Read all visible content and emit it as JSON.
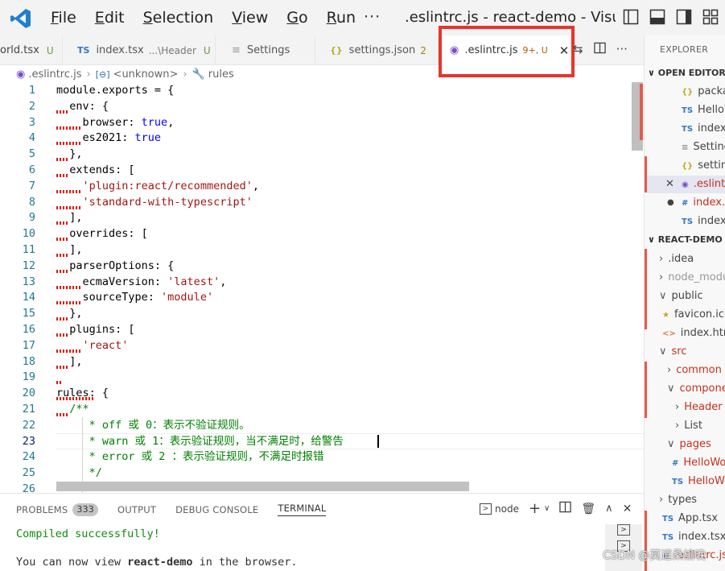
{
  "titlebar": {
    "menus": [
      "File",
      "Edit",
      "Selection",
      "View",
      "Go",
      "Run"
    ],
    "menu_accel": [
      "F",
      "E",
      "S",
      "V",
      "G",
      "R"
    ],
    "more": "···",
    "title": ".eslintrc.js - react-demo - Visual Studio Code"
  },
  "tabs": [
    {
      "label": "orld.tsx",
      "status": "U"
    },
    {
      "icon": "TS",
      "label": "index.tsx",
      "desc": "...\\Header",
      "status": "U"
    },
    {
      "label": "Settings"
    },
    {
      "icon": "{}",
      "label": "settings.json",
      "status": "2"
    },
    {
      "label": ".eslintrc.js",
      "status": "9+, U"
    }
  ],
  "breadcrumb": [
    ".eslintrc.js",
    "<unknown>",
    "rules"
  ],
  "code": [
    {
      "n": "1",
      "t": [
        [
          "t",
          "module.exports = {"
        ]
      ]
    },
    {
      "n": "2",
      "t": [
        [
          "t",
          "  env: {"
        ]
      ]
    },
    {
      "n": "3",
      "t": [
        [
          "t",
          "    browser: "
        ],
        [
          "k",
          "true"
        ],
        [
          "t",
          ","
        ]
      ]
    },
    {
      "n": "4",
      "t": [
        [
          "t",
          "    es2021: "
        ],
        [
          "k",
          "true"
        ]
      ]
    },
    {
      "n": "5",
      "t": [
        [
          "t",
          "  },"
        ]
      ]
    },
    {
      "n": "6",
      "t": [
        [
          "t",
          "  extends: ["
        ]
      ]
    },
    {
      "n": "7",
      "t": [
        [
          "t",
          "    "
        ],
        [
          "s",
          "'plugin:react/recommended'"
        ],
        [
          "t",
          ","
        ]
      ]
    },
    {
      "n": "8",
      "t": [
        [
          "t",
          "    "
        ],
        [
          "s",
          "'standard-with-typescript'"
        ]
      ]
    },
    {
      "n": "9",
      "t": [
        [
          "t",
          "  ],"
        ]
      ]
    },
    {
      "n": "10",
      "t": [
        [
          "t",
          "  overrides: ["
        ]
      ]
    },
    {
      "n": "11",
      "t": [
        [
          "t",
          "  ],"
        ]
      ]
    },
    {
      "n": "12",
      "t": [
        [
          "t",
          "  parserOptions: {"
        ]
      ]
    },
    {
      "n": "13",
      "t": [
        [
          "t",
          "    ecmaVersion: "
        ],
        [
          "s",
          "'latest'"
        ],
        [
          "t",
          ","
        ]
      ]
    },
    {
      "n": "14",
      "t": [
        [
          "t",
          "    sourceType: "
        ],
        [
          "s",
          "'module'"
        ]
      ]
    },
    {
      "n": "15",
      "t": [
        [
          "t",
          "  },"
        ]
      ]
    },
    {
      "n": "16",
      "t": [
        [
          "t",
          "  plugins: ["
        ]
      ]
    },
    {
      "n": "17",
      "t": [
        [
          "t",
          "    "
        ],
        [
          "s",
          "'react'"
        ]
      ]
    },
    {
      "n": "18",
      "t": [
        [
          "t",
          "  ],"
        ]
      ]
    },
    {
      "n": "19",
      "t": [
        [
          "t",
          ""
        ]
      ]
    },
    {
      "n": "20",
      "t": [
        [
          "t",
          "rules: {"
        ]
      ]
    },
    {
      "n": "21",
      "t": [
        [
          "c",
          "  /**"
        ]
      ]
    },
    {
      "n": "22",
      "t": [
        [
          "c",
          "     * off 或 0：表示不验证规则。"
        ]
      ]
    },
    {
      "n": "23",
      "t": [
        [
          "c",
          "     * warn 或 1：表示验证规则，当不满足时，给警告"
        ]
      ]
    },
    {
      "n": "24",
      "t": [
        [
          "c",
          "     * error 或 2 ：表示验证规则，不满足时报错"
        ]
      ]
    },
    {
      "n": "25",
      "t": [
        [
          "c",
          "     */"
        ]
      ]
    },
    {
      "n": "26",
      "t": [
        [
          "t",
          ""
        ]
      ]
    }
  ],
  "panel": {
    "tabs": [
      "PROBLEMS",
      "OUTPUT",
      "DEBUG CONSOLE",
      "TERMINAL"
    ],
    "problems_count": "333",
    "shell": "node",
    "line1": "Compiled successfully!",
    "line2_pre": "You can now view ",
    "line2_bold": "react-demo",
    "line2_post": " in the browser."
  },
  "explorer": {
    "title": "EXPLORER",
    "open_editors": "OPEN EDITORS",
    "open": [
      {
        "icon": "{}",
        "label": "package.json"
      },
      {
        "icon": "TS",
        "label": "HelloWorld.tsx"
      },
      {
        "icon": "TS",
        "label": "index.tsx"
      },
      {
        "icon": "≡",
        "label": "Settings"
      },
      {
        "icon": "{}",
        "label": "settings.json"
      },
      {
        "icon": "◉",
        "label": ".eslintrc.js"
      },
      {
        "icon": "#",
        "label": "index.css"
      },
      {
        "icon": "TS",
        "label": "index.tsx"
      }
    ],
    "project": "REACT-DEMO",
    "tree": [
      {
        "label": ".idea"
      },
      {
        "label": "node_modules"
      },
      {
        "label": "public"
      },
      {
        "icon": "★",
        "label": "favicon.ico"
      },
      {
        "icon": "<>",
        "label": "index.html"
      },
      {
        "label": "src"
      },
      {
        "label": "common"
      },
      {
        "label": "components"
      },
      {
        "label": "Header"
      },
      {
        "label": "List"
      },
      {
        "label": "pages"
      },
      {
        "icon": "#",
        "label": "HelloWorld.css"
      },
      {
        "icon": "TS",
        "label": "HelloWorld.tsx"
      },
      {
        "label": "types"
      },
      {
        "icon": "TS",
        "label": "App.tsx"
      },
      {
        "icon": "TS",
        "label": "index.tsx"
      },
      {
        "icon": "◉",
        "label": ".eslintrc.js"
      }
    ]
  },
  "watermark": "CSDN @莫道桑榆晚"
}
